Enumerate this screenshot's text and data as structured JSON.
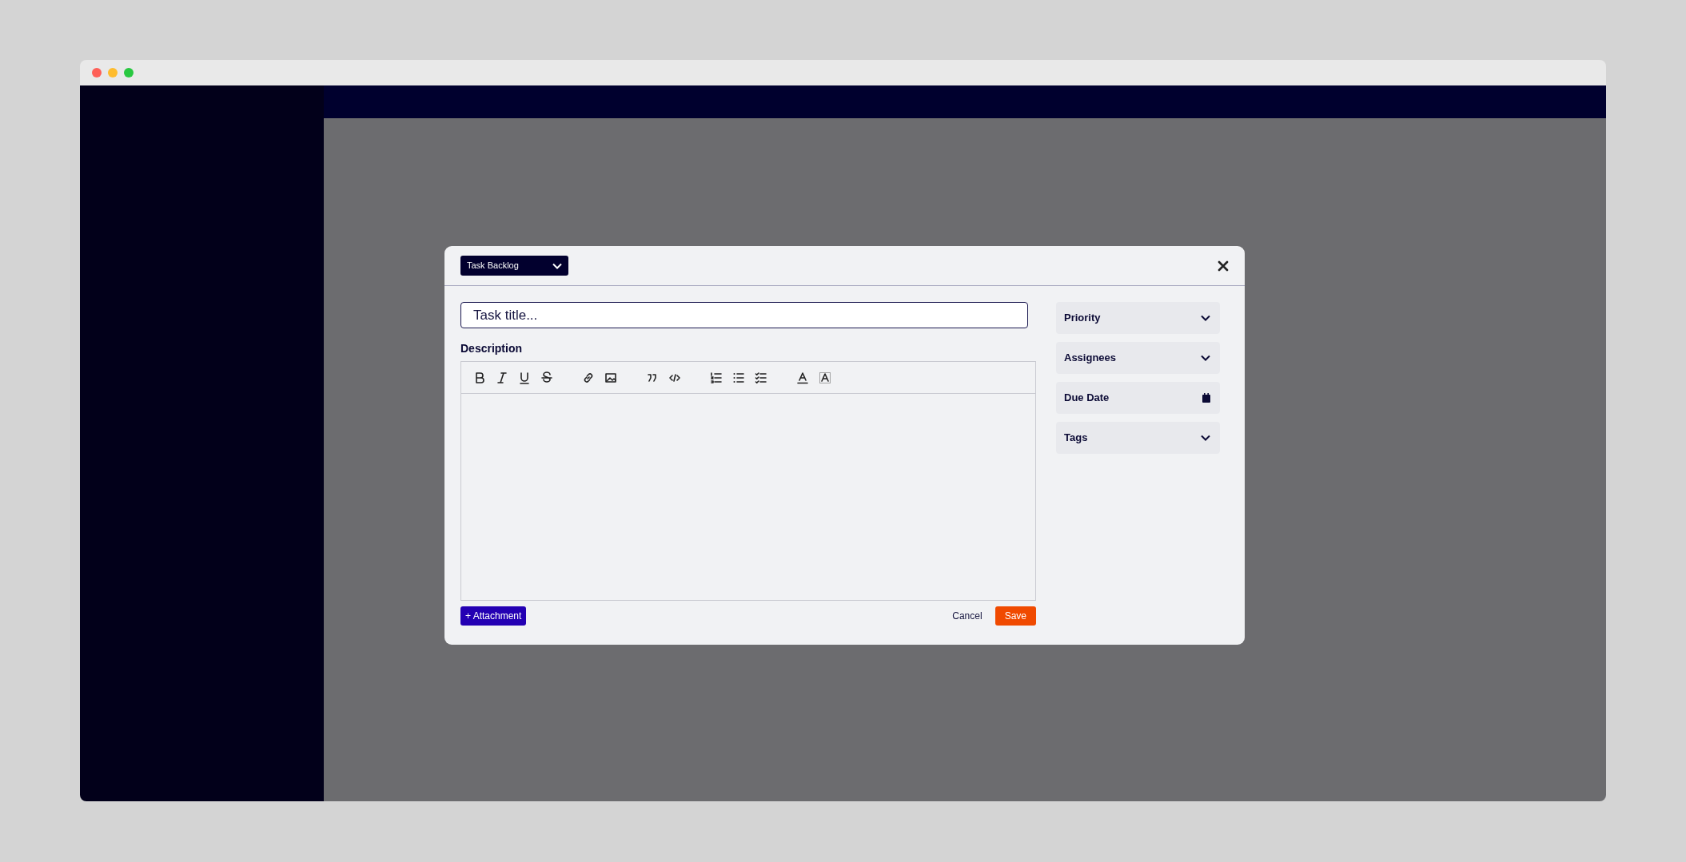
{
  "status_select": {
    "label": "Task Backlog"
  },
  "title_field": {
    "placeholder": "Task title..."
  },
  "description": {
    "label": "Description"
  },
  "buttons": {
    "attachment": "+ Attachment",
    "cancel": "Cancel",
    "save": "Save"
  },
  "side_fields": [
    {
      "label": "Priority",
      "kind": "dropdown"
    },
    {
      "label": "Assignees",
      "kind": "dropdown"
    },
    {
      "label": "Due Date",
      "kind": "date"
    },
    {
      "label": "Tags",
      "kind": "dropdown"
    }
  ]
}
